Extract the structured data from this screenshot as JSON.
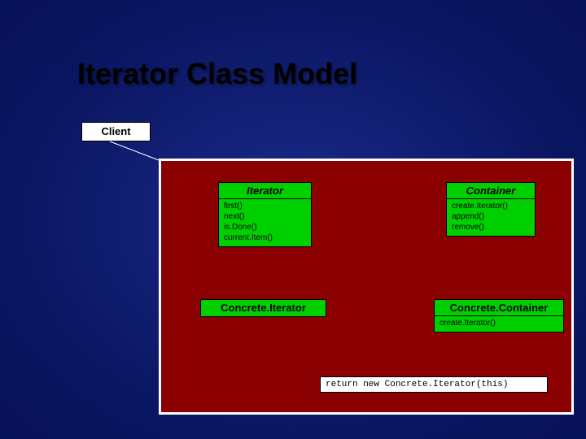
{
  "title": "Iterator Class Model",
  "client": {
    "label": "Client"
  },
  "iterator": {
    "name": "Iterator",
    "methods": [
      "first()",
      "next()",
      "is.Done()",
      "current.Item()"
    ]
  },
  "container": {
    "name": "Container",
    "methods": [
      "create.Iterator()",
      "append()",
      "remove()"
    ]
  },
  "concreteIterator": {
    "name": "Concrete.Iterator"
  },
  "concreteContainer": {
    "name": "Concrete.Container",
    "methods": [
      "create.Iterator()"
    ]
  },
  "code": "return new Concrete.Iterator(this)"
}
